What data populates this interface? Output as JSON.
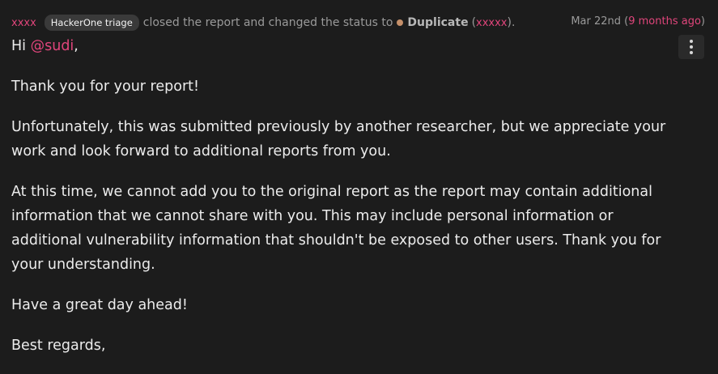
{
  "activity": {
    "actor": "xxxx",
    "badge": "HackerOne triage",
    "action_text": "closed the report and changed the status to",
    "status": "Duplicate",
    "status_color": "#c5906a",
    "duplicate_ref": "xxxxx",
    "date": "Mar 22nd",
    "relative_time": "9 months ago"
  },
  "menu": {
    "icon": "more-vertical-icon"
  },
  "message": {
    "greeting_prefix": "Hi",
    "mention": "@sudi",
    "greeting_suffix": ",",
    "paragraphs": [
      "Thank you for your report!",
      "Unfortunately, this was submitted previously by another researcher, but we appreciate your work and look forward to additional reports from you.",
      "At this time, we cannot add you to the original report as the report may contain additional information that we cannot share with you. This may include personal information or additional vulnerability information that shouldn't be exposed to other users. Thank you for your understanding.",
      "Have a great day ahead!",
      "Best regards,"
    ]
  },
  "colors": {
    "background": "#1c1c1c",
    "accent": "#e0457b"
  }
}
